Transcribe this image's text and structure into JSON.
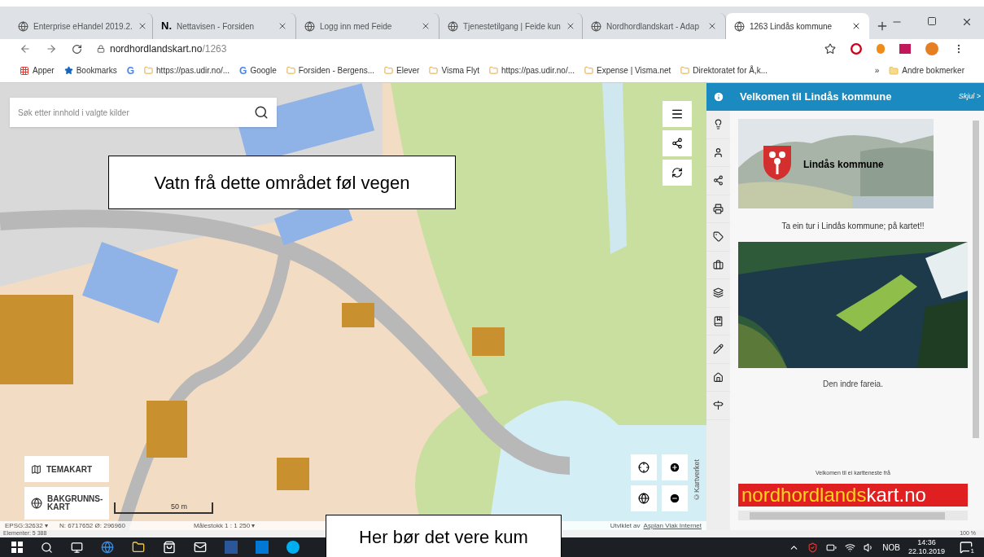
{
  "browser": {
    "tabs": [
      {
        "title": "Enterprise eHandel 2019.2.",
        "selected": false
      },
      {
        "title": "Nettavisen - Forsiden",
        "icon_text": "N.",
        "selected": false
      },
      {
        "title": "Logg inn med Feide",
        "selected": false
      },
      {
        "title": "Tjenestetilgang | Feide kun",
        "selected": false
      },
      {
        "title": "Nordhordlandskart - Adap",
        "selected": false
      },
      {
        "title": "1263 Lindås kommune",
        "selected": true
      }
    ],
    "address": {
      "host": "nordhordlandskart.no",
      "path": "/1263"
    },
    "bookmarks": [
      {
        "label": "Apper"
      },
      {
        "label": "Bookmarks"
      },
      {
        "icon_text": "G"
      },
      {
        "label": "https://pas.udir.no/..."
      },
      {
        "icon_text": "G",
        "label": "Google"
      },
      {
        "label": "Forsiden - Bergens..."
      },
      {
        "label": "Elever"
      },
      {
        "label": "Visma Flyt"
      },
      {
        "label": "https://pas.udir.no/..."
      },
      {
        "label": "Expense | Visma.net"
      },
      {
        "label": "Direktoratet for Å,k..."
      }
    ],
    "more": "»",
    "other_bookmarks": "Andre bokmerker"
  },
  "map": {
    "search": {
      "placeholder": "Søk etter innhold i valgte kilder"
    },
    "layer_buttons": [
      "TEMAKART",
      "BAKGRUNNS-KART"
    ],
    "scale": "50 m",
    "attribution": "©Kartverket",
    "status_bar": {
      "projection": "EPSG:32632 ▾",
      "coordinates": "N: 6717652 Ø: 296960",
      "scale_text": "Målestokk 1 : 1 250 ▾",
      "credit": "Utviklet av",
      "credit_link": "Asplan Viak Internet"
    },
    "elements": "Elementer: 5 388",
    "zoom": "100 %"
  },
  "annotations": [
    "Vatn frå dette området føl vegen",
    "Her bør det vere kum"
  ],
  "sidebar": {
    "title": "Velkomen til Lindås kommune",
    "hide": "Skjul >",
    "side_tabs": [
      {
        "selected": true
      },
      {
        "selected": false
      },
      {
        "selected": false
      },
      {
        "selected": false
      },
      {
        "selected": false
      },
      {
        "selected": false
      },
      {
        "selected": false
      },
      {
        "selected": false
      },
      {
        "selected": false
      },
      {
        "selected": false
      },
      {
        "selected": false
      },
      {
        "selected": false
      }
    ],
    "banner_text": "Lindås kommune",
    "caption_1": "Ta ein tur i Lindås kommune; på kartet!!",
    "caption_2": "Den indre fareia.",
    "footer": "Velkomen til ei kartteneste frå",
    "logo_1": "nordhordlands",
    "logo_2": "kart.no"
  },
  "taskbar": {
    "language": "NOB",
    "time": "14:36",
    "date": "22.10.2019",
    "notifications": "1"
  }
}
